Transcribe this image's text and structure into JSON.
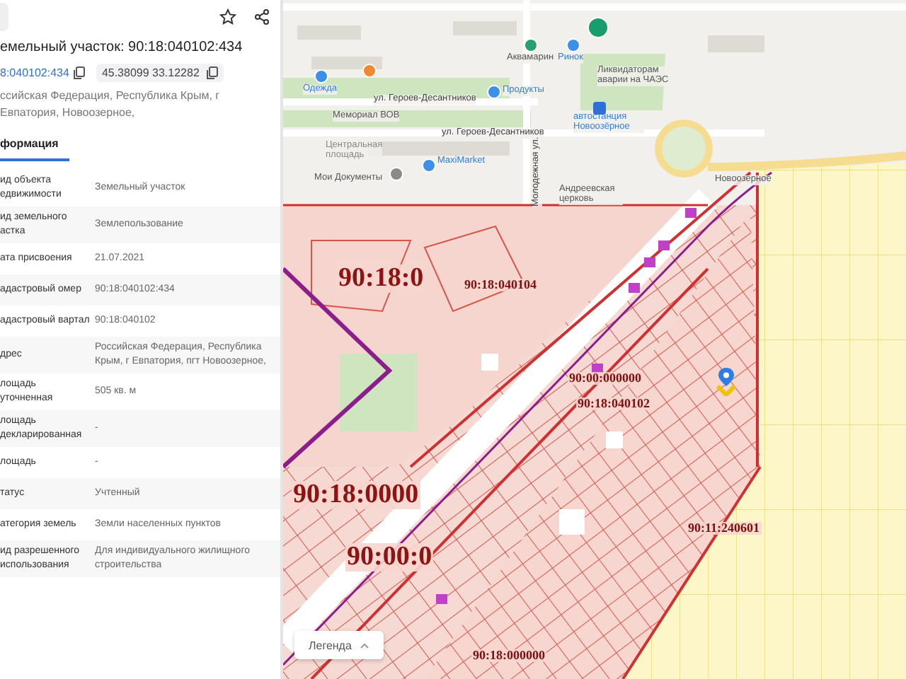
{
  "panel": {
    "title": "емельный участок: 90:18:040102:434",
    "cadastral_link": "8:040102:434",
    "coordinates": "45.38099 33.12282",
    "address": "ссийская Федерация, Республика Крым, г Евпатория, Новоозерное,",
    "tabs": [
      {
        "label": "формация",
        "selected": true
      }
    ],
    "rows": [
      {
        "label": "ид объекта едвижимости",
        "value": "Земельный участок"
      },
      {
        "label": "ид земельного астка",
        "value": "Землепользование"
      },
      {
        "label": "ата присвоения",
        "value": "21.07.2021"
      },
      {
        "label": "адастровый омер",
        "value": "90:18:040102:434"
      },
      {
        "label": "адастровый вартал",
        "value": "90:18:040102"
      },
      {
        "label": "дрес",
        "value": "Российская Федерация, Республика Крым, г Евпатория, пгт Новоозерное,"
      },
      {
        "label": "лощадь уточненная",
        "value": "505 кв. м"
      },
      {
        "label": "лощадь декларированная",
        "value": "-"
      },
      {
        "label": "лощадь",
        "value": "-"
      },
      {
        "label": "татус",
        "value": "Учтенный"
      },
      {
        "label": "атегория земель",
        "value": "Земли населенных пунктов"
      },
      {
        "label": "ид разрешенного использования",
        "value": "Для индивидуального жилищного строительства"
      }
    ]
  },
  "map": {
    "labels": [
      {
        "text": "Аквамарин",
        "kind": "poi"
      },
      {
        "text": "Ринок",
        "kind": "poi-blue"
      },
      {
        "text": "Ликвидаторам аварии на ЧАЭС",
        "kind": "poi"
      },
      {
        "text": "Одежда",
        "kind": "poi-blue"
      },
      {
        "text": "Продукты",
        "kind": "poi-blue"
      },
      {
        "text": "ул. Героев-Десантников",
        "kind": "street"
      },
      {
        "text": "Мемориал ВОВ",
        "kind": "poi"
      },
      {
        "text": "автостанция Новоозёрное",
        "kind": "poi-blue"
      },
      {
        "text": "ул. Героев-Десантников",
        "kind": "street"
      },
      {
        "text": "Центральная площадь",
        "kind": "place"
      },
      {
        "text": "MaxiMarket",
        "kind": "poi-blue"
      },
      {
        "text": "Мои Документы",
        "kind": "poi"
      },
      {
        "text": "Андреевская церковь",
        "kind": "poi"
      },
      {
        "text": "Новоозерное",
        "kind": "poi"
      },
      {
        "text": "Молодежная ул.",
        "kind": "street-vertical"
      },
      {
        "text": "90:18:0",
        "kind": "cadastral-large"
      },
      {
        "text": "90:18:040104",
        "kind": "cadastral"
      },
      {
        "text": "90:00:000000",
        "kind": "cadastral"
      },
      {
        "text": "90:18:040102",
        "kind": "cadastral"
      },
      {
        "text": "90:18:0000",
        "kind": "cadastral-large"
      },
      {
        "text": "90:11:240601",
        "kind": "cadastral"
      },
      {
        "text": "90:00:0",
        "kind": "cadastral-large"
      },
      {
        "text": "90:18:000000",
        "kind": "cadastral"
      }
    ],
    "legend_button": "Легенда"
  }
}
